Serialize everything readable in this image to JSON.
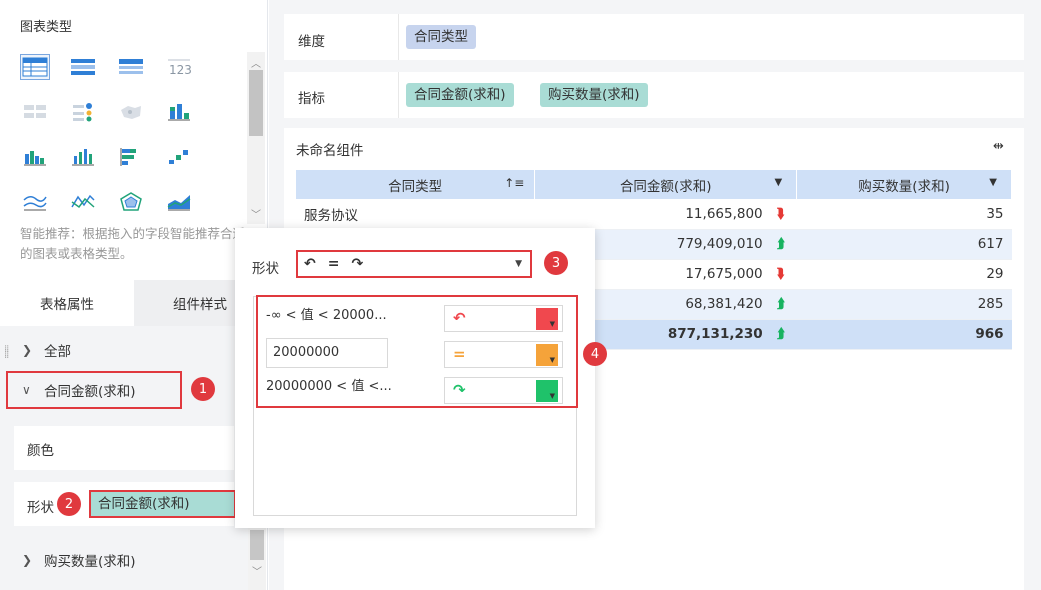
{
  "left_panel": {
    "chart_type_title": "图表类型",
    "chart_icons": [
      "table-basic-icon",
      "table-cross-icon",
      "table-detail-icon",
      "kpi-number-icon",
      "kpi-card-icon",
      "dot-list-icon",
      "map-icon",
      "bar-stack-icon",
      "column-icon",
      "column-multi-icon",
      "bar-horizontal-icon",
      "waterfall-icon",
      "line-icon",
      "line-multi-icon",
      "radar-icon",
      "area-icon"
    ],
    "smart_tip": "智能推荐：根据拖入的字段智能推荐合适的图表或表格类型。",
    "tabs": {
      "table_props": "表格属性",
      "component_style": "组件样式"
    },
    "tree": {
      "all": "全部",
      "contract_amount": "合同金额(求和)",
      "color": "颜色",
      "shape": "形状",
      "shape_field": "合同金额(求和)",
      "purchase_qty": "购买数量(求和)"
    }
  },
  "badges": [
    "1",
    "2",
    "3",
    "4"
  ],
  "right_panel": {
    "dimension_label": "维度",
    "dimension_fields": [
      "合同类型"
    ],
    "measure_label": "指标",
    "measure_fields": [
      "合同金额(求和)",
      "购买数量(求和)"
    ],
    "component_title": "未命名组件",
    "table": {
      "headers": [
        "合同类型",
        "合同金额(求和)",
        "购买数量(求和)"
      ],
      "rows": [
        {
          "type": "服务协议",
          "amount": "11,665,800",
          "arrow": "down",
          "qty": "35"
        },
        {
          "type": "",
          "amount": "779,409,010",
          "arrow": "up",
          "qty": "617"
        },
        {
          "type": "",
          "amount": "17,675,000",
          "arrow": "down",
          "qty": "29"
        },
        {
          "type": "",
          "amount": "68,381,420",
          "arrow": "up",
          "qty": "285"
        }
      ],
      "total": {
        "amount": "877,131,230",
        "arrow": "up",
        "qty": "966"
      }
    }
  },
  "popup": {
    "shape_label": "形状",
    "shape_select_glyphs": [
      "↶",
      "=",
      "↷"
    ],
    "rules": [
      {
        "text": "-∞ < 值 < 20000...",
        "symbol": "↶",
        "color": "#f0484e"
      },
      {
        "value": "20000000",
        "symbol": "=",
        "color": "#f5a33a"
      },
      {
        "text": "20000000 < 值 <...",
        "symbol": "↷",
        "color": "#1fc26a"
      }
    ]
  }
}
